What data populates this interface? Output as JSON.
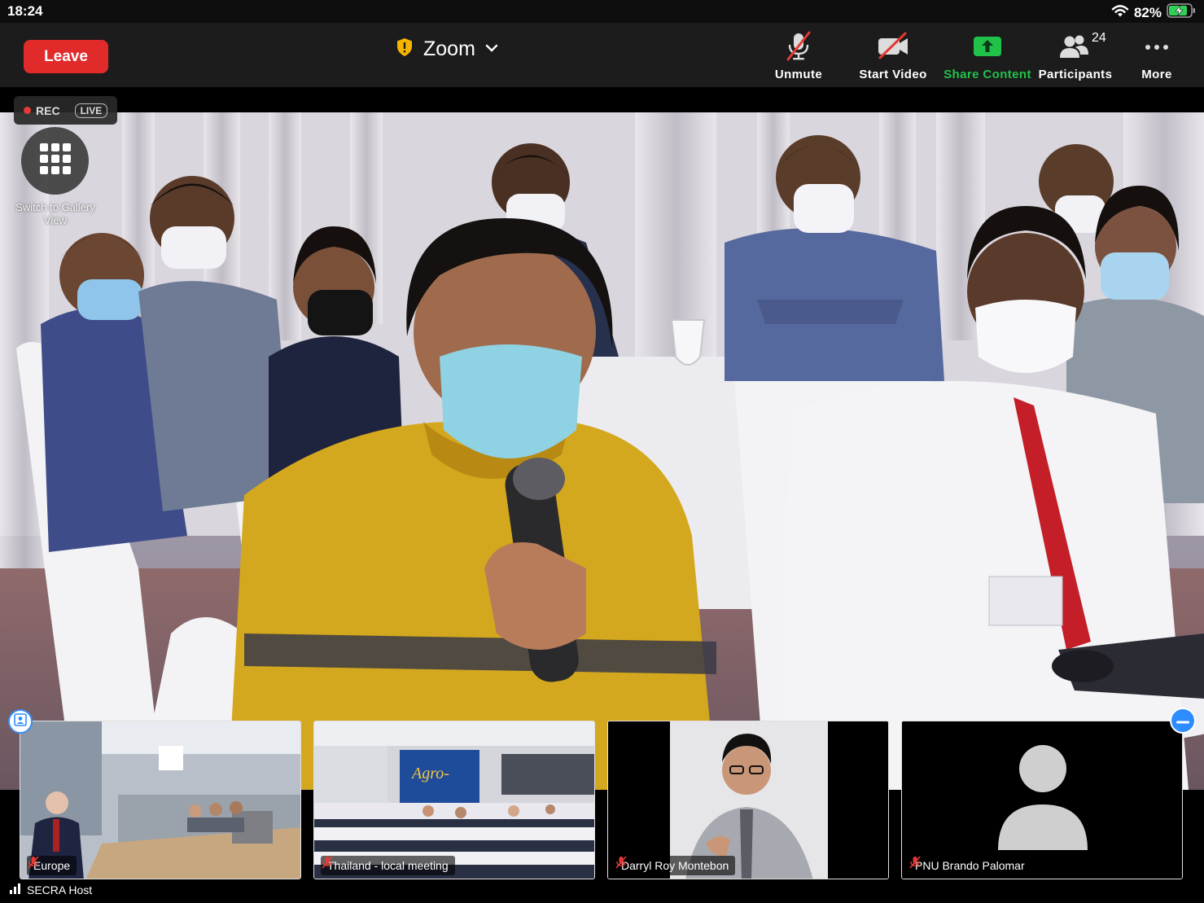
{
  "status_bar": {
    "time": "18:24",
    "battery": "82%"
  },
  "toolbar": {
    "leave_label": "Leave",
    "meeting_title": "Zoom",
    "unmute_label": "Unmute",
    "start_video_label": "Start Video",
    "share_content_label": "Share Content",
    "participants_label": "Participants",
    "participants_count": "24",
    "more_label": "More"
  },
  "recording": {
    "rec_label": "REC",
    "live_label": "LIVE"
  },
  "gallery_switch": {
    "label": "Switch to Gallery View"
  },
  "thumbnails": [
    {
      "name": "Europe"
    },
    {
      "name": "Thailand - local meeting"
    },
    {
      "name": "Darryl Roy Montebon"
    },
    {
      "name": "PNU Brando Palomar"
    }
  ],
  "host": {
    "label": "SECRA Host"
  },
  "colors": {
    "leave_red": "#e12a2a",
    "share_green": "#20c24a",
    "accent_blue": "#2d8cff",
    "toolbar_bg": "#1c1c1c"
  },
  "icons": {
    "shield": "shield-icon",
    "chevron": "chevron-down-icon",
    "unmute": "microphone-muted-icon",
    "video": "video-off-icon",
    "share": "share-arrow-icon",
    "participants": "participants-icon",
    "more": "more-dots-icon",
    "gallery": "grid-icon",
    "signal": "signal-bars-icon"
  }
}
